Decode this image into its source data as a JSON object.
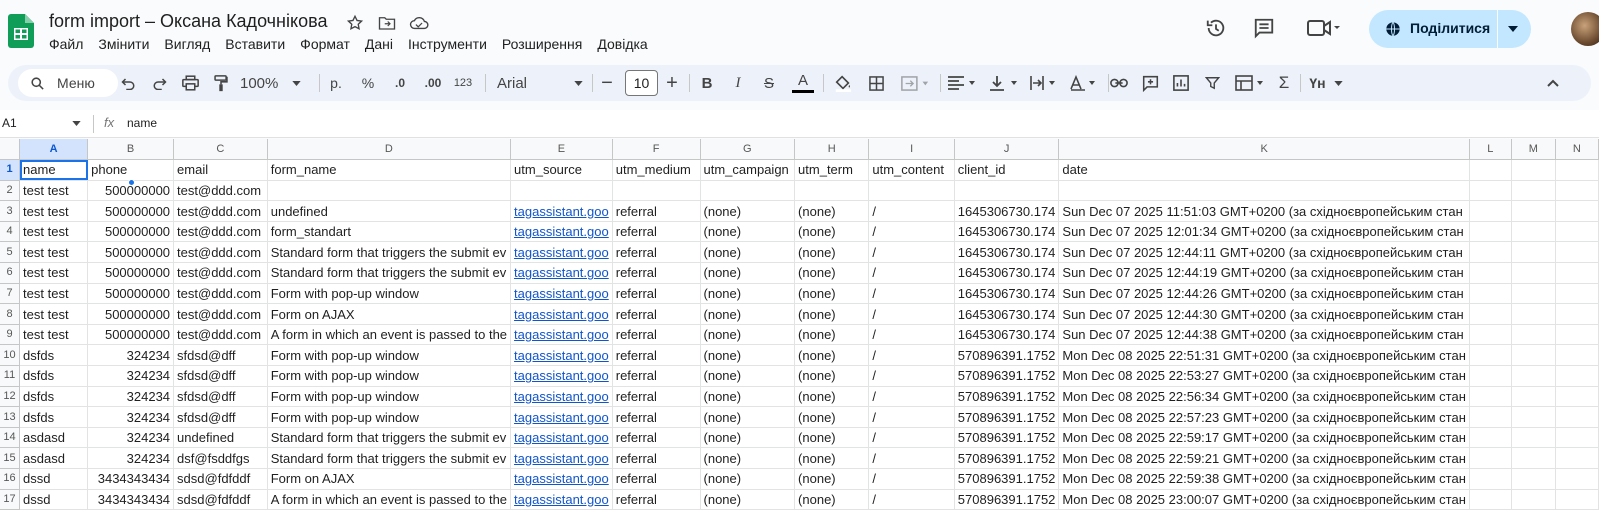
{
  "app": {
    "doc_title": "form import – Оксана Кадочнікова",
    "menu": [
      "Файл",
      "Змінити",
      "Вигляд",
      "Вставити",
      "Формат",
      "Дані",
      "Інструменти",
      "Розширення",
      "Довідка"
    ],
    "share_label": "Поділитися",
    "accent": "#0b57d0",
    "share_bg": "#c2e7ff"
  },
  "toolbar": {
    "search_label": "Меню",
    "zoom": "100%",
    "currency": "р.",
    "percent": "%",
    "dec_less": ".0",
    "dec_more": ".00",
    "format_123": "123",
    "font": "Arial",
    "font_size": "10"
  },
  "formula": {
    "cell_ref": "A1",
    "fx": "fx",
    "value": "name"
  },
  "sheet": {
    "columns": [
      "A",
      "B",
      "C",
      "D",
      "E",
      "F",
      "G",
      "H",
      "I",
      "J",
      "K",
      "L",
      "M",
      "N"
    ],
    "header_row": [
      "name",
      "phone",
      "email",
      "form_name",
      "utm_source",
      "utm_medium",
      "utm_campaign",
      "utm_term",
      "utm_content",
      "client_id",
      "date"
    ],
    "rows": [
      [
        "test test",
        "500000000",
        "test@ddd.com",
        "",
        "",
        "",
        "",
        "",
        "",
        "",
        ""
      ],
      [
        "test test",
        "500000000",
        "test@ddd.com",
        "undefined",
        "tagassistant.goo",
        "referral",
        "(none)",
        "(none)",
        "/",
        "1645306730.174",
        "Sun Dec 07 2025 11:51:03 GMT+0200 (за східноєвропейським стан"
      ],
      [
        "test test",
        "500000000",
        "test@ddd.com",
        "form_standart",
        "tagassistant.goo",
        "referral",
        "(none)",
        "(none)",
        "/",
        "1645306730.174",
        "Sun Dec 07 2025 12:01:34 GMT+0200 (за східноєвропейським стан"
      ],
      [
        "test test",
        "500000000",
        "test@ddd.com",
        "Standard form that triggers the submit ev",
        "tagassistant.goo",
        "referral",
        "(none)",
        "(none)",
        "/",
        "1645306730.174",
        "Sun Dec 07 2025 12:44:11 GMT+0200 (за східноєвропейським стан"
      ],
      [
        "test test",
        "500000000",
        "test@ddd.com",
        "Standard form that triggers the submit ev",
        "tagassistant.goo",
        "referral",
        "(none)",
        "(none)",
        "/",
        "1645306730.174",
        "Sun Dec 07 2025 12:44:19 GMT+0200 (за східноєвропейським стан"
      ],
      [
        "test test",
        "500000000",
        "test@ddd.com",
        "Form with pop-up window",
        "tagassistant.goo",
        "referral",
        "(none)",
        "(none)",
        "/",
        "1645306730.174",
        "Sun Dec 07 2025 12:44:26 GMT+0200 (за східноєвропейським стан"
      ],
      [
        "test test",
        "500000000",
        "test@ddd.com",
        "Form on AJAX",
        "tagassistant.goo",
        "referral",
        "(none)",
        "(none)",
        "/",
        "1645306730.174",
        "Sun Dec 07 2025 12:44:30 GMT+0200 (за східноєвропейським стан"
      ],
      [
        "test test",
        "500000000",
        "test@ddd.com",
        "A form in which an event is passed to the",
        "tagassistant.goo",
        "referral",
        "(none)",
        "(none)",
        "/",
        "1645306730.174",
        "Sun Dec 07 2025 12:44:38 GMT+0200 (за східноєвропейським стан"
      ],
      [
        "dsfds",
        "324234",
        "sfdsd@dff",
        "Form with pop-up window",
        "tagassistant.goo",
        "referral",
        "(none)",
        "(none)",
        "/",
        "570896391.1752",
        "Mon Dec 08 2025 22:51:31 GMT+0200 (за східноєвропейським стан"
      ],
      [
        "dsfds",
        "324234",
        "sfdsd@dff",
        "Form with pop-up window",
        "tagassistant.goo",
        "referral",
        "(none)",
        "(none)",
        "/",
        "570896391.1752",
        "Mon Dec 08 2025 22:53:27 GMT+0200 (за східноєвропейським стан"
      ],
      [
        "dsfds",
        "324234",
        "sfdsd@dff",
        "Form with pop-up window",
        "tagassistant.goo",
        "referral",
        "(none)",
        "(none)",
        "/",
        "570896391.1752",
        "Mon Dec 08 2025 22:56:34 GMT+0200 (за східноєвропейським стан"
      ],
      [
        "dsfds",
        "324234",
        "sfdsd@dff",
        "Form with pop-up window",
        "tagassistant.goo",
        "referral",
        "(none)",
        "(none)",
        "/",
        "570896391.1752",
        "Mon Dec 08 2025 22:57:23 GMT+0200 (за східноєвропейським стан"
      ],
      [
        "asdasd",
        "324234",
        "undefined",
        "Standard form that triggers the submit ev",
        "tagassistant.goo",
        "referral",
        "(none)",
        "(none)",
        "/",
        "570896391.1752",
        "Mon Dec 08 2025 22:59:17 GMT+0200 (за східноєвропейським стан"
      ],
      [
        "asdasd",
        "324234",
        "dsf@fsddfgs",
        "Standard form that triggers the submit ev",
        "tagassistant.goo",
        "referral",
        "(none)",
        "(none)",
        "/",
        "570896391.1752",
        "Mon Dec 08 2025 22:59:21 GMT+0200 (за східноєвропейським стан"
      ],
      [
        "dssd",
        "3434343434",
        "sdsd@fdfddf",
        "Form on AJAX",
        "tagassistant.goo",
        "referral",
        "(none)",
        "(none)",
        "/",
        "570896391.1752",
        "Mon Dec 08 2025 22:59:38 GMT+0200 (за східноєвропейським стан"
      ],
      [
        "dssd",
        "3434343434",
        "sdsd@fdfddf",
        "A form in which an event is passed to the",
        "tagassistant.goo",
        "referral",
        "(none)",
        "(none)",
        "/",
        "570896391.1752",
        "Mon Dec 08 2025 23:00:07 GMT+0200 (за східноєвропейським стан"
      ]
    ]
  }
}
